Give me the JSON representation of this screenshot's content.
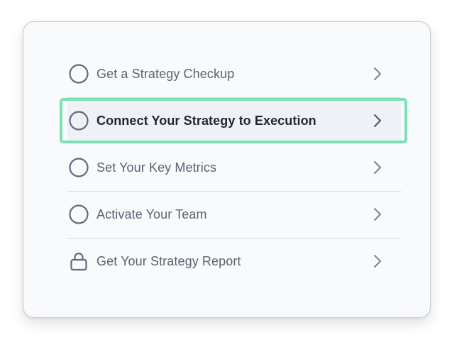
{
  "checklist": {
    "items": [
      {
        "label": "Get a Strategy Checkup",
        "icon": "circle-icon",
        "state": "incomplete"
      },
      {
        "label": "Connect Your Strategy to Execution",
        "icon": "circle-icon",
        "state": "current"
      },
      {
        "label": "Set Your Key Metrics",
        "icon": "circle-icon",
        "state": "incomplete"
      },
      {
        "label": "Activate Your Team",
        "icon": "circle-icon",
        "state": "incomplete"
      },
      {
        "label": "Get Your Strategy Report",
        "icon": "lock-icon",
        "state": "locked"
      }
    ],
    "chevron_icon": "chevron-right-icon",
    "colors": {
      "highlight_border": "#7ee0b2",
      "icon_stroke": "#5f6b7d",
      "label_text": "#5a6372",
      "active_label_text": "#1e2533",
      "chevron": "#7a8494"
    }
  }
}
